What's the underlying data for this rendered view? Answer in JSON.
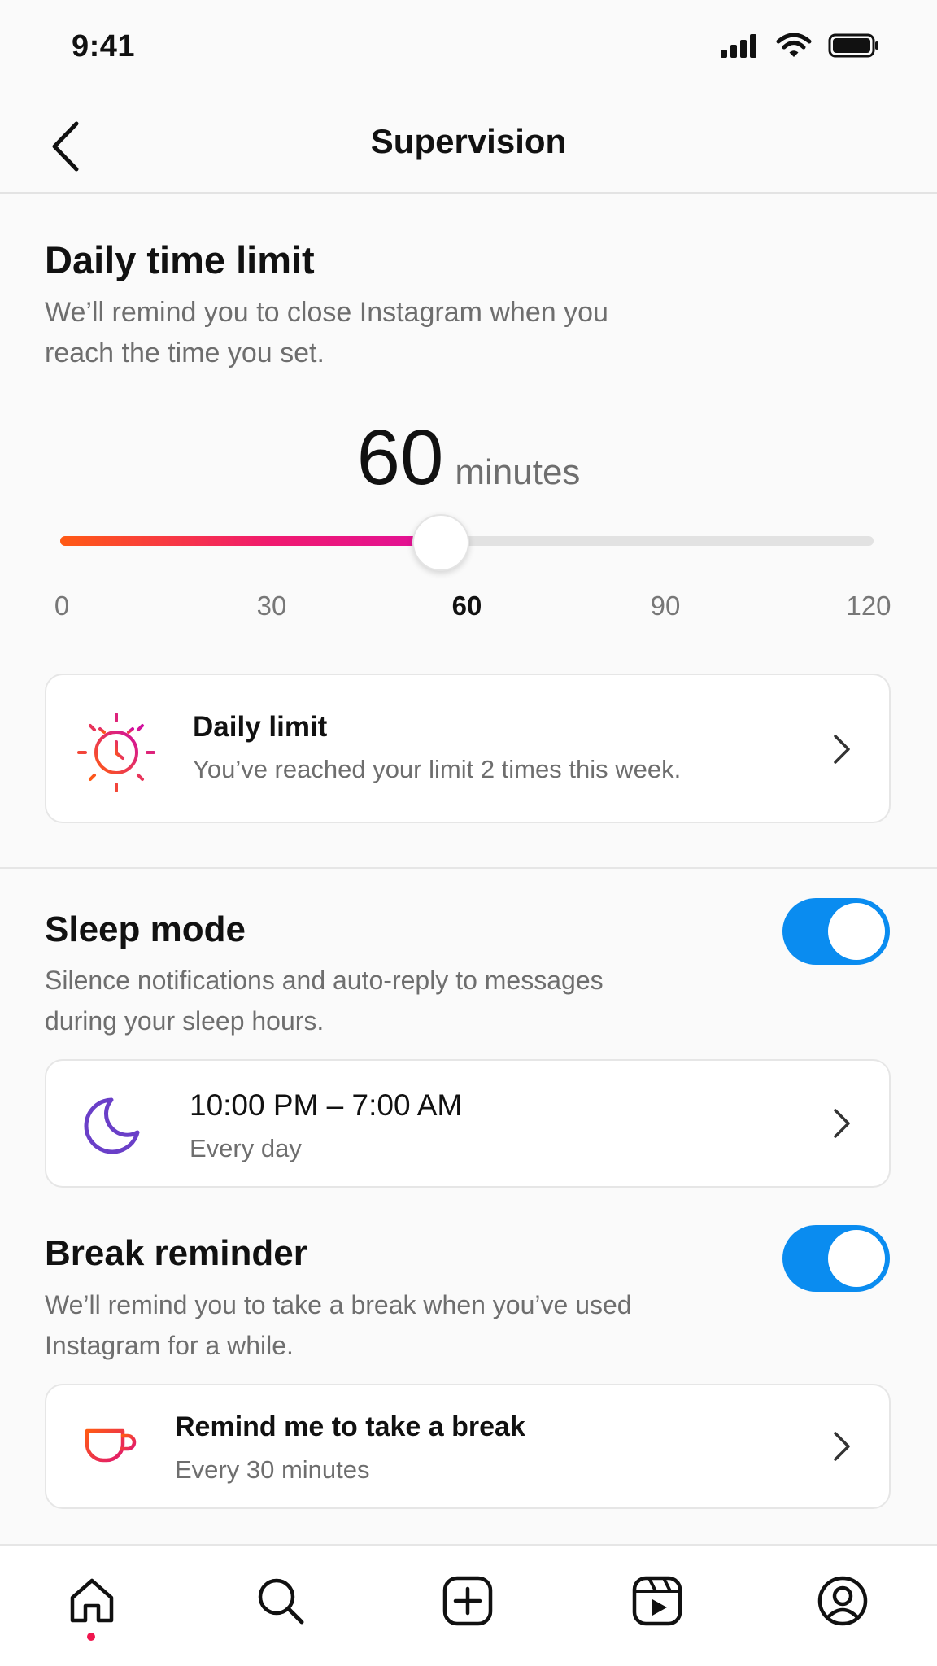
{
  "status_bar": {
    "time": "9:41"
  },
  "header": {
    "title": "Supervision",
    "back_icon": "chevron-left-icon"
  },
  "daily_time_limit": {
    "title": "Daily time limit",
    "description_line1": "We’ll remind you to close Instagram when you",
    "description_line2": "reach the time you set.",
    "value": "60",
    "unit": "minutes",
    "slider": {
      "min": 0,
      "max": 120,
      "current": 60,
      "fill_colors": [
        "#ff5a14",
        "#e0109a"
      ]
    },
    "ticks": [
      "0",
      "30",
      "60",
      "90",
      "120"
    ],
    "card": {
      "icon": "clock-sun-icon",
      "title": "Daily limit",
      "subtitle": "You’ve reached your limit 2 times this week."
    }
  },
  "sleep_mode": {
    "title": "Sleep mode",
    "enabled": true,
    "description_line1": "Silence notifications and auto-reply to messages",
    "description_line2": "during your sleep hours.",
    "card": {
      "icon": "moon-icon",
      "title": "10:00 PM – 7:00 AM",
      "subtitle": "Every day"
    }
  },
  "break_reminder": {
    "title": "Break reminder",
    "enabled": true,
    "description_line1": "We’ll remind you to take a break when you’ve used",
    "description_line2": "Instagram for a while.",
    "card": {
      "icon": "coffee-cup-icon",
      "title": "Remind me to take a break",
      "subtitle": "Every 30 minutes"
    }
  },
  "bottom_nav": {
    "items": [
      "home-icon",
      "search-icon",
      "create-icon",
      "reels-icon",
      "profile-icon"
    ],
    "active": "home-icon"
  },
  "colors": {
    "toggle_on": "#0a8cf0",
    "accent_pink": "#e0109a",
    "accent_orange": "#ff5a14",
    "moon_purple": "#6a3fc8"
  }
}
